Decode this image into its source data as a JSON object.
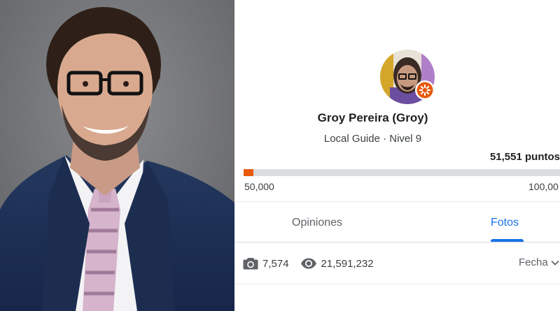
{
  "profile": {
    "name": "Groy Pereira (Groy)",
    "guide_level": "Local Guide · Nivel 9",
    "points": "51,551 puntos",
    "progress": {
      "min_label": "50,000",
      "max_label": "100,00",
      "fraction": 0.031
    },
    "badge_icon": "local-guide-star-badge-icon"
  },
  "tabs": [
    {
      "label": "Opiniones",
      "active": false
    },
    {
      "label": "Fotos",
      "active": true
    }
  ],
  "stats": {
    "photos_count": "7,574",
    "photos_icon": "camera-icon",
    "views_count": "21,591,232",
    "views_icon": "eye-icon"
  },
  "sort": {
    "label": "Fecha",
    "icon": "chevron-down-icon"
  },
  "colors": {
    "accent_blue": "#1a73e8",
    "progress_orange": "#e8590c",
    "track_gray": "#dadce0",
    "photo_background": "#7c7d80",
    "suit_navy": "#1f3152"
  }
}
